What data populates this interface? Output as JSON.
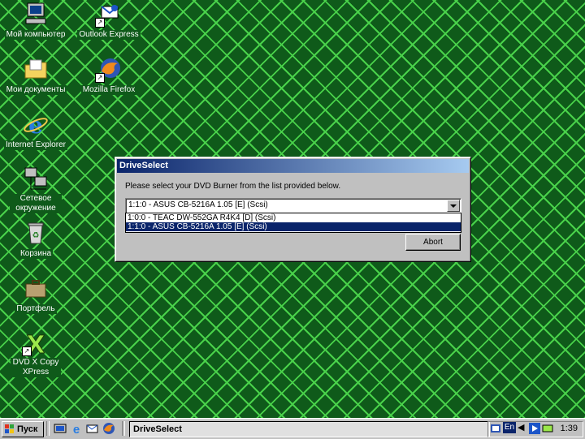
{
  "desktop": {
    "icons": [
      {
        "label": "Мой компьютер",
        "icon": "my-computer-icon"
      },
      {
        "label": "Outlook Express",
        "icon": "outlook-express-icon"
      },
      {
        "label": "Мои документы",
        "icon": "my-documents-icon"
      },
      {
        "label": "Mozilla Firefox",
        "icon": "firefox-icon"
      },
      {
        "label": "Internet Explorer",
        "icon": "internet-explorer-icon"
      },
      {
        "label": "Сетевое окружение",
        "icon": "network-icon"
      },
      {
        "label": "Корзина",
        "icon": "recycle-bin-icon"
      },
      {
        "label": "Портфель",
        "icon": "briefcase-icon"
      },
      {
        "label": "DVD X Copy XPress",
        "icon": "dvd-x-copy-icon"
      }
    ]
  },
  "dialog": {
    "title": "DriveSelect",
    "prompt": "Please select your DVD Burner from the list provided below.",
    "selected": "1:1:0 - ASUS CB-5216A 1.05 [E] (Scsi)",
    "options": [
      "1:0:0 - TEAC DW-552GA R4K4 [D] (Scsi)",
      "1:1:0 - ASUS CB-5216A 1.05 [E] (Scsi)"
    ],
    "abort_label": "Abort"
  },
  "taskbar": {
    "start_label": "Пуск",
    "task_label": "DriveSelect",
    "lang": "En",
    "clock": "1:39"
  },
  "colors": {
    "desktop_bg": "#0f5a1a",
    "grid_lines": "#49d14a",
    "title_active": "#0a246a",
    "selection": "#0a246a"
  }
}
